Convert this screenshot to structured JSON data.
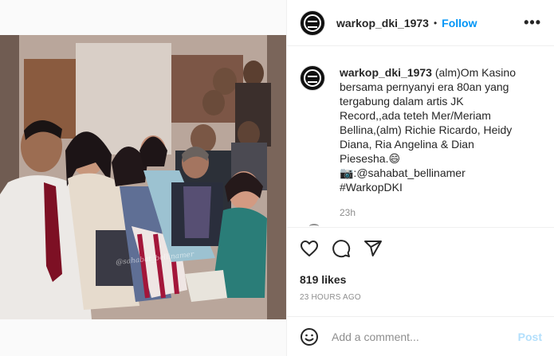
{
  "post": {
    "username": "warkop_dki_1973",
    "follow_label": "Follow",
    "separator": "•",
    "more_label": "•••",
    "caption": "(alm)Om Kasino bersama pernyanyi era 80an yang tergabung dalam artis JK Record,,ada teteh Mer/Meriam Bellina,(alm) Richie Ricardo, Heidy Diana, Ria Angelina & Dian Piesesha.😄 📷:@sahabat_bellinamer #WarkopDKI",
    "caption_time": "23h",
    "likes": "819 likes",
    "posted_ago": "23 HOURS AGO",
    "watermark": "@sahabat_bellinamer"
  },
  "comment_box": {
    "placeholder": "Add a comment...",
    "post_label": "Post"
  },
  "colors": {
    "link": "#0095f6",
    "muted": "#8e8e8e",
    "post_disabled": "#b2dffc"
  }
}
